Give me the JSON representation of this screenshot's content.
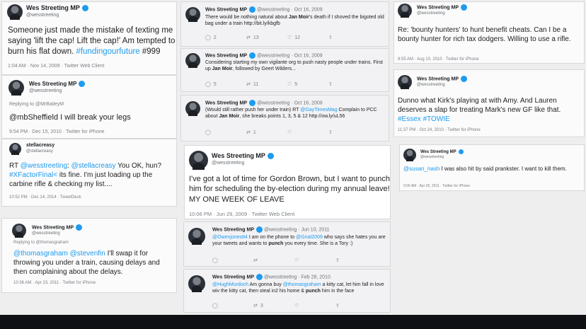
{
  "tweets": [
    {
      "name": "Wes Streeting MP",
      "handle": "@wesstreeting",
      "text_a": "Someone just made the mistake of texting me saying 'lift the cap! Lift the cap!' Am tempted to burn his flat down. ",
      "hashtag": "#fundingourfuture",
      "text_b": " #999",
      "meta": "1:04 AM · Nov 14, 2009 · Twitter Web Client"
    },
    {
      "name": "Wes Streeting MP",
      "handle": "@wesstreeting",
      "replying": "Replying to @MrBaileyM",
      "text": "@mbSheffield I will break your legs",
      "meta": "9:54 PM · Dec 15, 2010 · Twitter for iPhone"
    },
    {
      "name": "stellacreasy",
      "handle": "@stellacreasy",
      "text_pre": "RT ",
      "mention_a": "@wesstreeting",
      "text_mid": ": ",
      "mention_b": "@stellacreasy",
      "text_c": " You OK, hun? ",
      "tag": "#XFactorFinal<",
      "text_d": " its fine. I'm just loading up the carbine rifle & checking my list....",
      "meta": "10:52 PM · Dec 14, 2014 · TweetDeck"
    },
    {
      "name": "Wes Streeting MP",
      "handle": "@wesstreeting",
      "replying": "Replying to @thomasgraham",
      "mention_a": "@thomasgraham",
      "mention_b": "@stevenfin",
      "text": " I'll swap it for throwing you under a train, causing delays and then complaining about the delays.",
      "meta": "10:36 AM · Apr 23, 2011 · Twitter for iPhone"
    },
    {
      "name": "Wes Streeting MP",
      "handle": "@wesstreeting · Oct 16, 2009",
      "text_a": "There would be nothing natural about ",
      "bold": "Jan Moir",
      "text_b": "'s death if I shoved the bigoted old bag under a train http://bit.ly/kbgfb",
      "actions": [
        "2",
        "13",
        "12",
        ""
      ]
    },
    {
      "name": "Wes Streeting MP",
      "handle": "@wesstreeting · Oct 16, 2009",
      "text_a": "Considering starting my own vigilante org to push nasty people under trains. First up ",
      "bold": "Jan Moir",
      "text_b": ", followed by Geert Wilders...",
      "actions": [
        "5",
        "11",
        "5",
        ""
      ]
    },
    {
      "name": "Wes Streeting MP",
      "handle": "@wesstreeting · Oct 16, 2009",
      "text_a": "(Would still rather push her under train) RT ",
      "mention": "@GayTimesMag",
      "text_b": " Complain to PCC about ",
      "bold": "Jan Moir",
      "text_c": ", she breaks points 1, 3, 5 & 12 http://ow.ly/uL56",
      "actions": [
        "",
        "1",
        "",
        ""
      ]
    },
    {
      "name": "Wes Streeting MP",
      "handle": "@wesstreeting",
      "text": "I've got a lot of time for Gordon Brown, but I want to punch him for scheduling the by-election during my annual leave! MY ONE WEEK OF LEAVE",
      "meta": "10:06 PM · Jun 29, 2009 · Twitter Web Client"
    },
    {
      "name": "Wes Streeting MP",
      "handle": "@wesstreeting · Jun 10, 2011",
      "mention_a": "@Owenjones84",
      "text_a": " I am on the phone to ",
      "mention_b": "@Gnat2009",
      "text_b": " who says she hates you are your tweets and wants to ",
      "bold": "punch",
      "text_c": " you every time. She is a Tory :)",
      "actions": [
        "",
        "",
        "",
        ""
      ]
    },
    {
      "name": "Wes Streeting MP",
      "handle": "@wesstreeting · Feb 28, 2010",
      "mention_a": "@HughMurdoch",
      "text_a": " Am gonna buy ",
      "mention_b": "@thomasgraham",
      "text_b": " a kitty cat, let him fall in love wiv the kitty cat, then steal in2 his home & ",
      "bold": "punch",
      "text_c": " him in the face",
      "actions": [
        "",
        "3",
        "",
        ""
      ]
    },
    {
      "name": "Wes Streeting MP",
      "handle": "@wesstreeting",
      "text": "Re: 'bounty hunters' to hunt benefit cheats. Can I be a bounty hunter for rich tax dodgers. Willing to use a rifle.",
      "meta": "8:55 AM · Aug 10, 2010 · Twitter for iPhone"
    },
    {
      "name": "Wes Streeting MP",
      "handle": "@wesstreeting",
      "text": "Dunno what Kirk's playing at with Amy. And Lauren deserves a slap for treating Mark's new GF like that. ",
      "tags": "#Essex #TOWIE",
      "meta": "11:37 PM · Oct 24, 2010 · Twitter for iPhone"
    },
    {
      "name": "Wes Streeting MP",
      "handle": "@wesstreeting",
      "mention": "@susan_nash",
      "text": " I was also hit by said prankster. I want to kill them.",
      "meta": "9:06 AM · Apr 26, 2011 · Twitter for iPhone"
    }
  ],
  "icons": {
    "reply": "reply-icon",
    "retweet": "retweet-icon",
    "like": "like-icon",
    "share": "share-icon"
  }
}
